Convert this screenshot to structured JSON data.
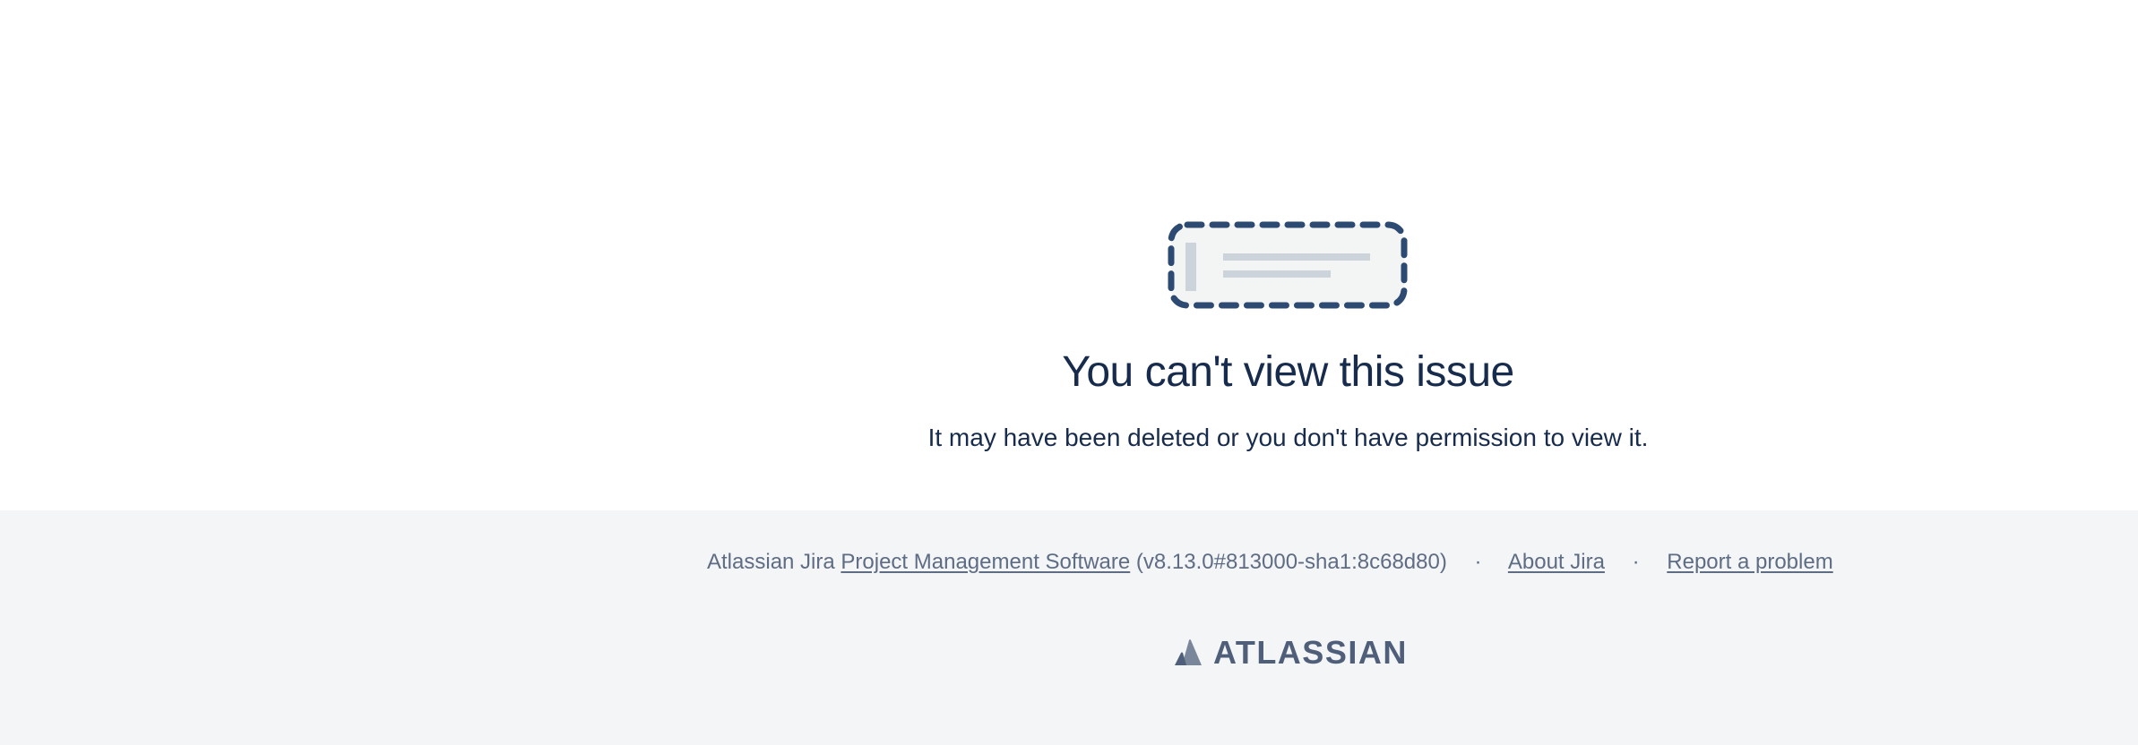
{
  "error": {
    "title": "You can't view this issue",
    "message": "It may have been deleted or you don't have permission to view it."
  },
  "footer": {
    "prefix": "Atlassian Jira",
    "product_link": "Project Management Software",
    "version": "(v8.13.0#813000-sha1:8c68d80)",
    "separator": "·",
    "about_link": "About Jira",
    "report_link": "Report a problem",
    "brand": "ATLASSIAN"
  },
  "colors": {
    "heading": "#172b4d",
    "footer_bg": "#f4f5f7",
    "footer_text": "#5e6c84",
    "illustration_border": "#2c4a72"
  }
}
